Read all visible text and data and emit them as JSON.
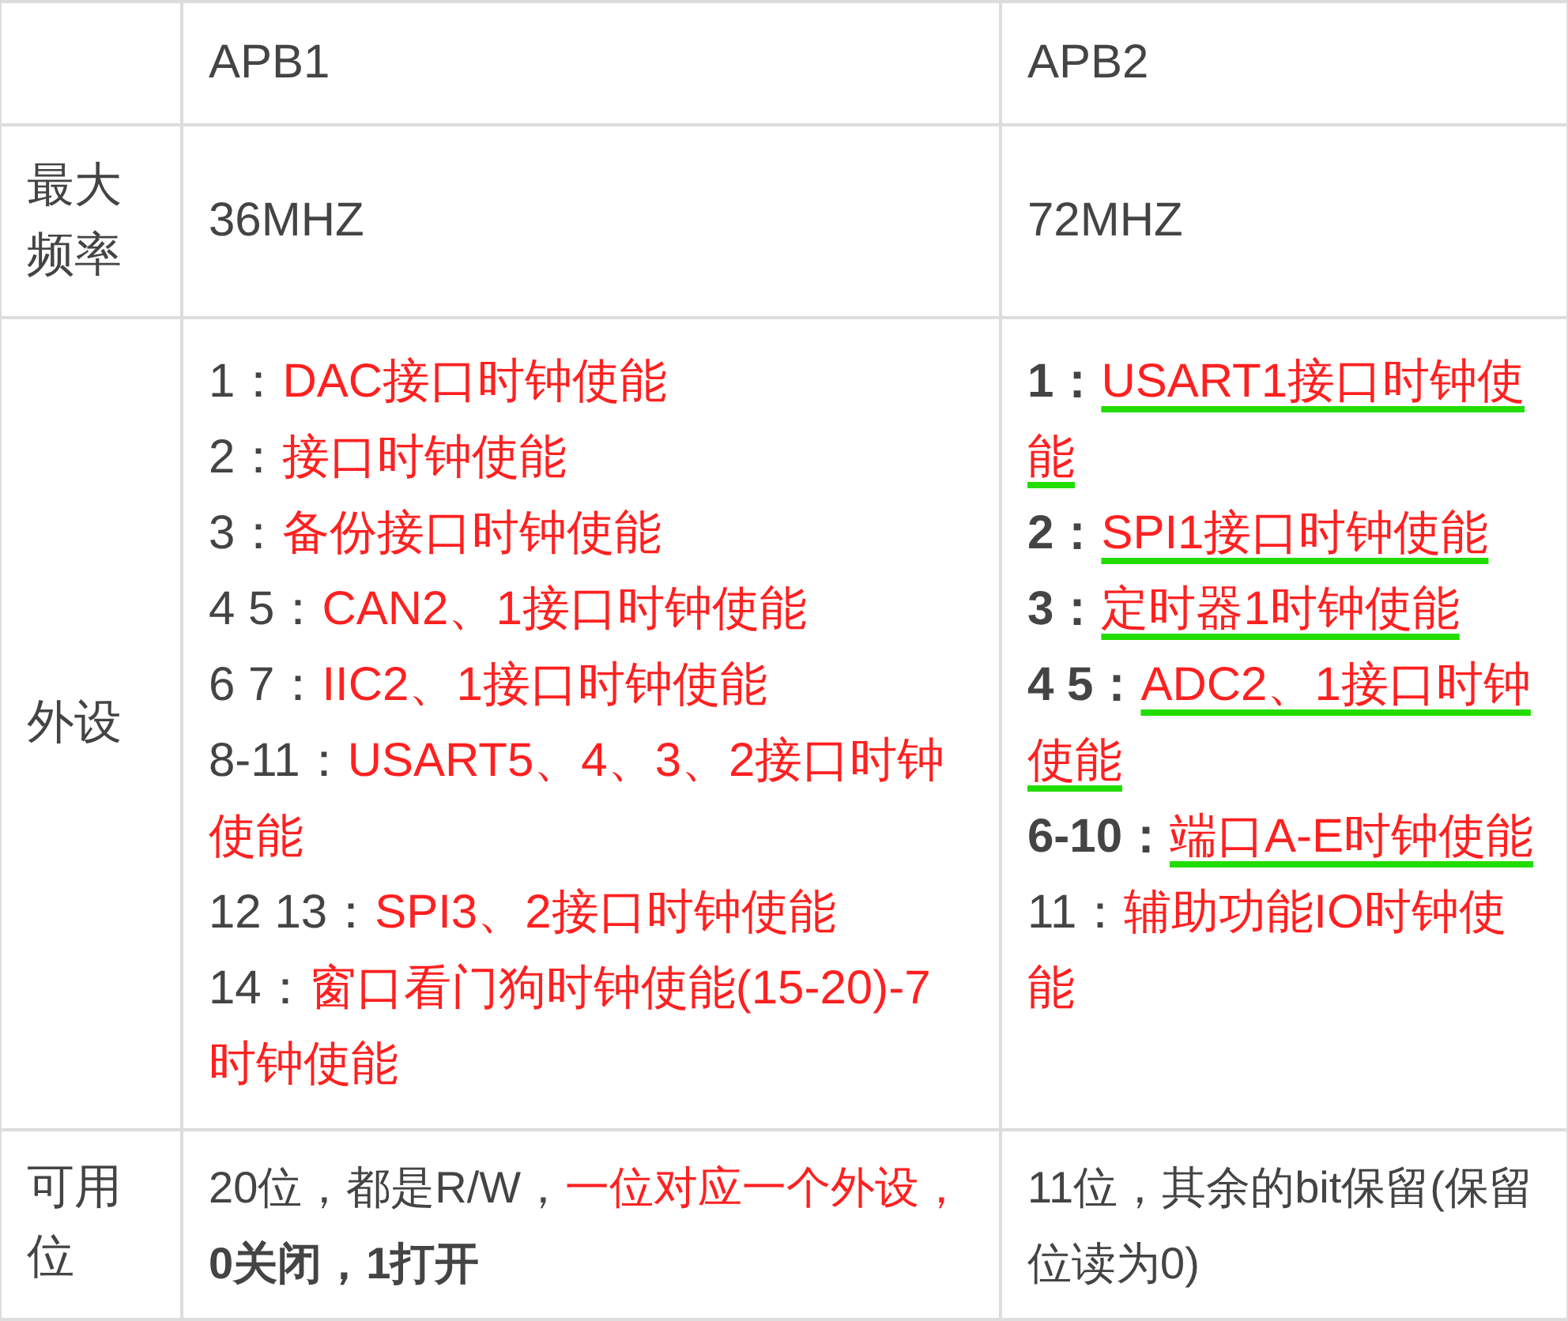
{
  "table": {
    "columns": [
      {
        "label": "APB1"
      },
      {
        "label": "APB2"
      }
    ],
    "rows": [
      {
        "label": "最大频率",
        "cells": [
          {
            "kind": "text",
            "segments": [
              {
                "kind": "plain",
                "text": "36MHZ"
              }
            ]
          },
          {
            "kind": "text",
            "segments": [
              {
                "kind": "plain",
                "text": "72MHZ"
              }
            ]
          }
        ]
      },
      {
        "label": "外设",
        "cells": [
          {
            "kind": "list",
            "entries": [
              {
                "number": "1：",
                "text": "DAC接口时钟使能",
                "bold_number": false,
                "underlined": false
              },
              {
                "number": "2：",
                "text": "接口时钟使能",
                "bold_number": false,
                "underlined": false
              },
              {
                "number": "3：",
                "text": "备份接口时钟使能",
                "bold_number": false,
                "underlined": false
              },
              {
                "number": "4 5：",
                "text": "CAN2、1接口时钟使能",
                "bold_number": false,
                "underlined": false
              },
              {
                "number": "6 7：",
                "text": "IIC2、1接口时钟使能",
                "bold_number": false,
                "underlined": false
              },
              {
                "number": "8-11：",
                "text": "USART5、4、3、2接口时钟使能",
                "bold_number": false,
                "underlined": false
              },
              {
                "number": "12 13：",
                "text": "SPI3、2接口时钟使能",
                "bold_number": false,
                "underlined": false
              },
              {
                "number": "14：",
                "text": "窗口看门狗时钟使能(15-20)-7时钟使能",
                "bold_number": false,
                "underlined": false
              }
            ]
          },
          {
            "kind": "list",
            "entries": [
              {
                "number": "1：",
                "text": "USART1接口时钟使能",
                "bold_number": true,
                "underlined": true
              },
              {
                "number": "2：",
                "text": "SPI1接口时钟使能",
                "bold_number": true,
                "underlined": true
              },
              {
                "number": "3：",
                "text": "定时器1时钟使能",
                "bold_number": true,
                "underlined": true
              },
              {
                "number": "4 5：",
                "text": "ADC2、1接口时钟使能",
                "bold_number": true,
                "underlined": true
              },
              {
                "number": "6-10：",
                "text": "端口A-E时钟使能",
                "bold_number": true,
                "underlined": true
              },
              {
                "number": "11：",
                "text": "辅助功能IO时钟使能",
                "bold_number": false,
                "underlined": false
              }
            ]
          }
        ]
      },
      {
        "label": "可用位",
        "cells": [
          {
            "kind": "text",
            "segments": [
              {
                "kind": "plain",
                "text": "20位，都是R/W，"
              },
              {
                "kind": "red",
                "text": "一位对应一个外设，"
              },
              {
                "kind": "bold",
                "text": "0关闭，1打开"
              }
            ]
          },
          {
            "kind": "text",
            "segments": [
              {
                "kind": "plain",
                "text": "11位，其余的bit保留(保留位读为0)"
              }
            ]
          }
        ]
      }
    ]
  }
}
